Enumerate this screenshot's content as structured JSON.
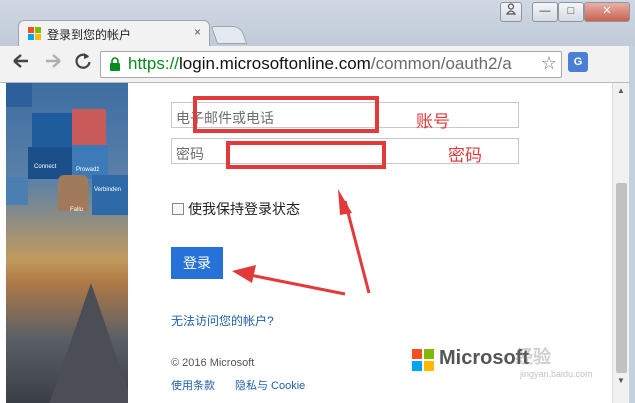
{
  "window": {
    "tab_title": "登录到您的帐户",
    "tab_close": "×",
    "controls": {
      "min": "—",
      "max": "□",
      "close": "✕"
    }
  },
  "toolbar": {
    "url_scheme": "https://",
    "url_host": "login.microsoftonline.com",
    "url_path": "/common/oauth2/a",
    "icons": [
      "back-icon",
      "forward-icon",
      "reload-icon",
      "lock-icon",
      "star-icon",
      "translate-icon",
      "menu-icon"
    ]
  },
  "hero": {
    "labels": [
      "Connect",
      "Verbinden",
      "Prowadź",
      "Fallu"
    ]
  },
  "form": {
    "email_placeholder": "电子邮件或电话",
    "password_placeholder": "密码",
    "remember_label": "使我保持登录状态",
    "signin_label": "登录",
    "cant_access_label": "无法访问您的帐户?"
  },
  "footer": {
    "copyright": "© 2016 Microsoft",
    "terms": "使用条款",
    "privacy": "隐私与 Cookie",
    "brand": "Microsoft"
  },
  "annotations": {
    "account_label": "账号",
    "password_label": "密码",
    "color": "#e23a3a"
  },
  "watermark": {
    "main": "经验",
    "sub": "jingyan.baidu.com"
  },
  "colors": {
    "accent": "#2672d8",
    "link": "#1f5fa8",
    "url_scheme": "#0a8a1f"
  }
}
